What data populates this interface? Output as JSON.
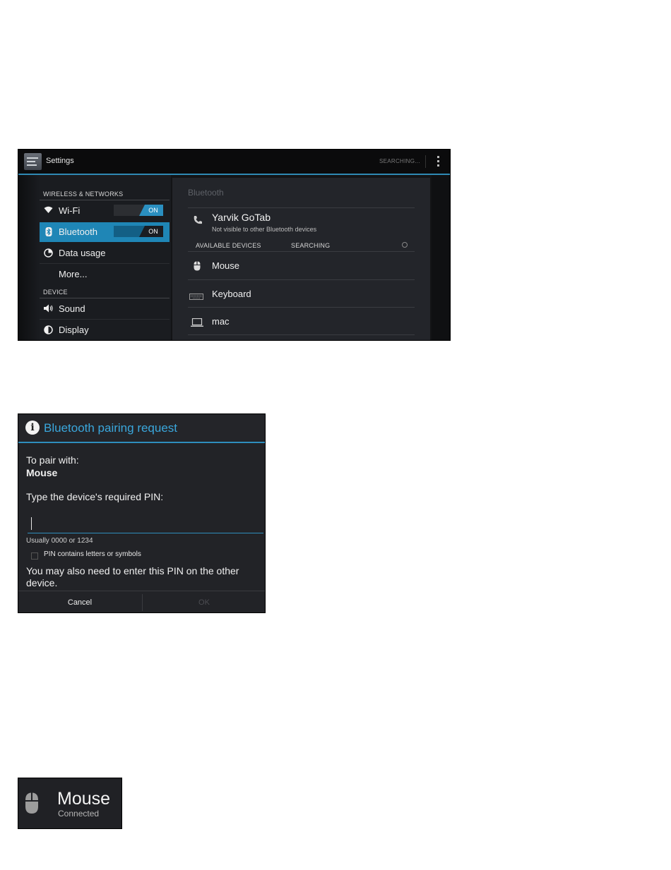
{
  "settings": {
    "app_title": "Settings",
    "status": "SEARCHING...",
    "left_nav": {
      "section_wireless": "WIRELESS & NETWORKS",
      "wifi": {
        "label": "Wi-Fi",
        "toggle": "ON"
      },
      "bluetooth": {
        "label": "Bluetooth",
        "toggle": "ON"
      },
      "data_usage": "Data usage",
      "more": "More...",
      "section_device": "DEVICE",
      "sound": "Sound",
      "display": "Display"
    },
    "right_pane": {
      "title": "Bluetooth",
      "this_device": {
        "name": "Yarvik GoTab",
        "status": "Not visible to other Bluetooth devices"
      },
      "available_header": "AVAILABLE DEVICES",
      "searching_label": "SEARCHING",
      "devices": [
        {
          "name": "Mouse",
          "icon": "mouse-icon"
        },
        {
          "name": "Keyboard",
          "icon": "keyboard-icon"
        },
        {
          "name": "mac",
          "icon": "laptop-icon"
        }
      ]
    },
    "accent_color": "#2f89b4"
  },
  "pairing_dialog": {
    "title": "Bluetooth pairing request",
    "pair_with_label": "To pair with:",
    "device_name": "Mouse",
    "pin_prompt": "Type the device's required PIN:",
    "pin_value": "",
    "hint": "Usually 0000 or 1234",
    "checkbox_label": "PIN contains letters or symbols",
    "note": "You may also need to enter this PIN on the other device.",
    "cancel_label": "Cancel",
    "ok_label": "OK",
    "title_color": "#3aa7dc"
  },
  "connected_notice": {
    "device_name": "Mouse",
    "status": "Connected"
  }
}
